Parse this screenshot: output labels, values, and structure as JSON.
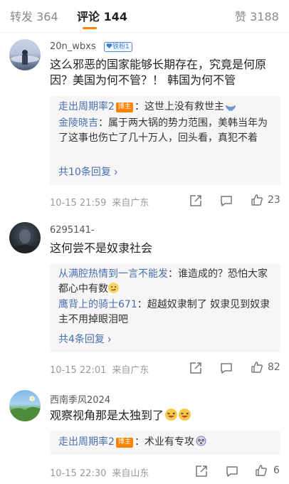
{
  "tabs": {
    "reposts_label": "转发",
    "reposts_count": "364",
    "comments_label": "评论",
    "comments_count": "144",
    "likes_label": "赞",
    "likes_count": "3188"
  },
  "comments": [
    {
      "username": "20n_wbxs",
      "fan_badge": "铁粉1",
      "text": "这么邪恶的国家能够长期存在，究竟是何原因？美国为何不管？！ 韩国为何不管",
      "replies": [
        {
          "name": "走出周期率2",
          "badge": "博主",
          "text": "：这世上没有救世主"
        },
        {
          "name": "金陵晓吉",
          "text": "：属于两大锅的势力范围，美韩当年为了这事也伤亡了几十万人，回头看，真犯不着"
        }
      ],
      "more_replies": "共10条回复",
      "time": "10-15 21:59",
      "location": "来自广东",
      "likes": "23"
    },
    {
      "username": "6295141-",
      "text": "这何尝不是奴隶社会",
      "replies": [
        {
          "name": "从满腔热情到一言不能发",
          "text": "：谁造成的？恐怕大家都心中有数"
        },
        {
          "name": "鹰背上的骑士671",
          "text": "：超越奴隶制了 奴隶见到奴隶主不用掉眼泪吧"
        }
      ],
      "more_replies": "共4条回复",
      "time": "10-15 22:01",
      "location": "来自广东",
      "likes": "82"
    },
    {
      "username": "西南季风2024",
      "text": "观察视角那是太独到了",
      "replies": [
        {
          "name": "走出周期率2",
          "badge": "博主",
          "text": "：术业有专攻"
        }
      ],
      "time": "10-15 22:30",
      "location": "来自山东",
      "likes": "6"
    }
  ],
  "colors": {
    "accent": "#ff8200",
    "link": "#4a6fb0",
    "badge_blue": "#3b7ed6"
  }
}
